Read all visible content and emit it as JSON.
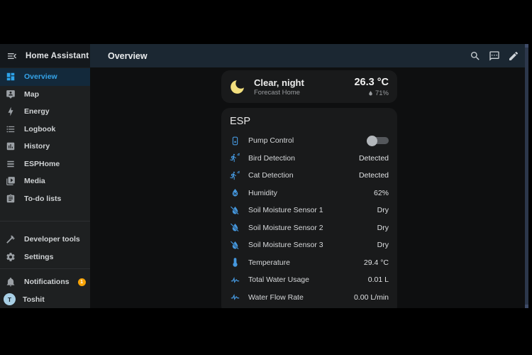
{
  "app": {
    "title": "Home Assistant",
    "menu_icon": "menu-open"
  },
  "header": {
    "title": "Overview",
    "actions": [
      {
        "name": "search",
        "icon": "magnify"
      },
      {
        "name": "assist",
        "icon": "message-processing"
      },
      {
        "name": "edit-dashboard",
        "icon": "pencil"
      }
    ]
  },
  "sidebar": {
    "items": [
      {
        "label": "Overview",
        "icon": "view-dashboard",
        "active": true
      },
      {
        "label": "Map",
        "icon": "tooltip-account"
      },
      {
        "label": "Energy",
        "icon": "lightning-bolt"
      },
      {
        "label": "Logbook",
        "icon": "format-list-bulleted"
      },
      {
        "label": "History",
        "icon": "chart-box"
      },
      {
        "label": "ESPHome",
        "icon": "layers"
      },
      {
        "label": "Media",
        "icon": "play-box-multiple"
      },
      {
        "label": "To-do lists",
        "icon": "clipboard-list"
      }
    ],
    "bottom_items": [
      {
        "label": "Developer tools",
        "icon": "hammer"
      },
      {
        "label": "Settings",
        "icon": "cog"
      }
    ],
    "notifications": {
      "label": "Notifications",
      "icon": "bell",
      "badge": "1"
    },
    "user": {
      "name": "Toshit",
      "avatar_initial": "T"
    }
  },
  "weather_card": {
    "icon": "weather-night",
    "condition": "Clear, night",
    "subtitle": "Forecast Home",
    "temperature": "26.3 °C",
    "humidity": "71%",
    "humidity_icon": "water"
  },
  "esp_card": {
    "title": "ESP",
    "rows": [
      {
        "name": "Pump Control",
        "icon": "pump",
        "control": "toggle",
        "toggle_state": "off"
      },
      {
        "name": "Bird Detection",
        "icon": "motion-sensor",
        "value": "Detected"
      },
      {
        "name": "Cat Detection",
        "icon": "motion-sensor",
        "value": "Detected"
      },
      {
        "name": "Humidity",
        "icon": "water-percent",
        "value": "62%"
      },
      {
        "name": "Soil Moisture Sensor 1",
        "icon": "water-off",
        "value": "Dry"
      },
      {
        "name": "Soil Moisture Sensor 2",
        "icon": "water-off",
        "value": "Dry"
      },
      {
        "name": "Soil Moisture Sensor 3",
        "icon": "water-off",
        "value": "Dry"
      },
      {
        "name": "Temperature",
        "icon": "thermometer",
        "value": "29.4 °C"
      },
      {
        "name": "Total Water Usage",
        "icon": "pulse",
        "value": "0.01 L"
      },
      {
        "name": "Water Flow Rate",
        "icon": "pulse",
        "value": "0.00 L/min"
      }
    ]
  },
  "colors": {
    "accent_blue": "#35a4ea",
    "entity_icon_blue": "#4597dd",
    "notification_badge": "#f7a306",
    "moon_yellow": "#f2df7e",
    "avatar_bg": "#a8cfe5",
    "header_bg": "#1b2732",
    "card_bg": "#191a1b",
    "sidebar_bg": "#1e2021",
    "content_bg": "#0e0f10"
  }
}
